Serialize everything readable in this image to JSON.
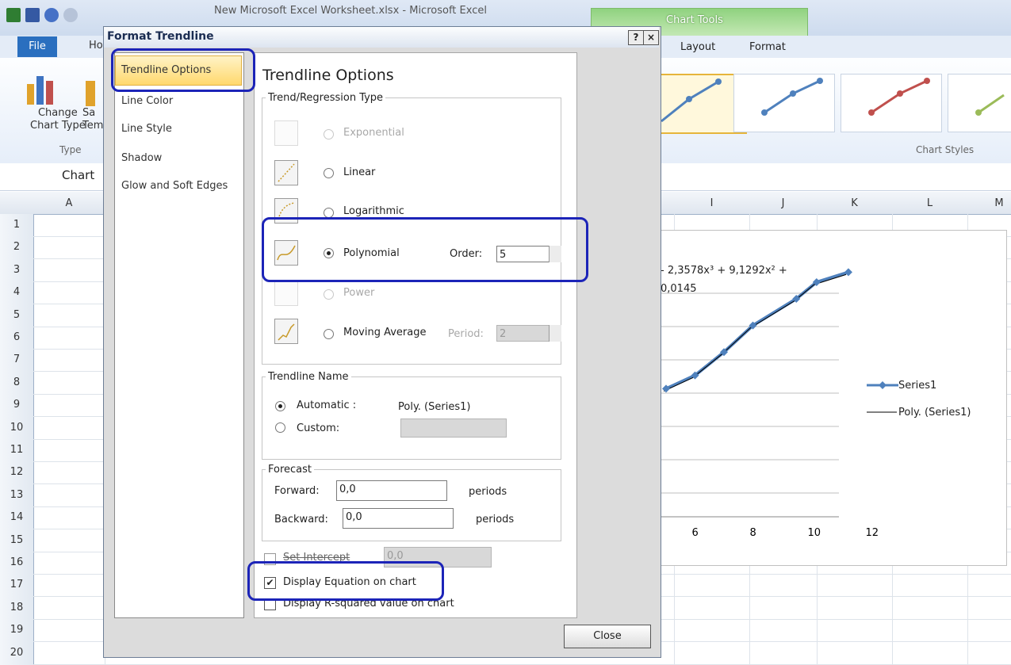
{
  "excel": {
    "window_title": "New Microsoft Excel Worksheet.xlsx - Microsoft Excel",
    "chart_tools": "Chart Tools",
    "tabs": {
      "file": "File",
      "home": "Ho",
      "layout": "Layout",
      "format": "Format"
    },
    "ribbon": {
      "change_chart_type": "Change\nChart Type",
      "save_template": "Sa\nTem",
      "group_type": "Type",
      "group_chart_styles": "Chart Styles"
    },
    "name_box": "Chart",
    "columns": [
      "A",
      "I",
      "J",
      "K",
      "L",
      "M"
    ],
    "rows": [
      "1",
      "2",
      "3",
      "4",
      "5",
      "6",
      "7",
      "8",
      "9",
      "10",
      "11",
      "12",
      "13",
      "14",
      "15",
      "16",
      "17",
      "18",
      "19",
      "20"
    ]
  },
  "chart": {
    "equation_line1": "- 2,3578x³ + 9,1292x² +",
    "equation_line2": "0,0145",
    "x_ticks": [
      "6",
      "8",
      "10",
      "12"
    ],
    "legend": [
      "Series1",
      "Poly. (Series1)"
    ],
    "style_colors": [
      "#4f81bd",
      "#4f81bd",
      "#c0504d",
      "#9bbb59"
    ]
  },
  "chart_data": {
    "type": "line",
    "x": [
      5,
      6,
      7,
      8,
      9.5,
      10.2,
      11.3
    ],
    "series": [
      {
        "name": "Series1",
        "values": [
          7.8,
          8.2,
          8.9,
          9.7,
          10.5,
          11.0,
          11.3
        ]
      }
    ],
    "xlabel": "",
    "ylabel": "",
    "x_ticks": [
      6,
      8,
      10,
      12
    ]
  },
  "dialog": {
    "title": "Format Trendline",
    "help_btn": "?",
    "close_btn": "×",
    "nav": [
      "Trendline Options",
      "Line Color",
      "Line Style",
      "Shadow",
      "Glow and Soft Edges"
    ],
    "pane_title": "Trendline Options",
    "trend_group": "Trend/Regression Type",
    "types": {
      "exponential": "Exponential",
      "linear": "Linear",
      "logarithmic": "Logarithmic",
      "polynomial": "Polynomial",
      "power": "Power",
      "moving_average": "Moving Average"
    },
    "order_label": "Order:",
    "order_value": "5",
    "period_label": "Period:",
    "period_value": "2",
    "name_group": "Trendline Name",
    "automatic_label": "Automatic :",
    "automatic_value": "Poly. (Series1)",
    "custom_label": "Custom:",
    "forecast_group": "Forecast",
    "forward_label": "Forward:",
    "forward_value": "0,0",
    "backward_label": "Backward:",
    "backward_value": "0,0",
    "periods": "periods",
    "set_intercept": "Set Intercept",
    "intercept_value": "0,0",
    "display_equation": "Display Equation on chart",
    "display_rsquared": "Display R-squared value on chart",
    "close": "Close"
  }
}
